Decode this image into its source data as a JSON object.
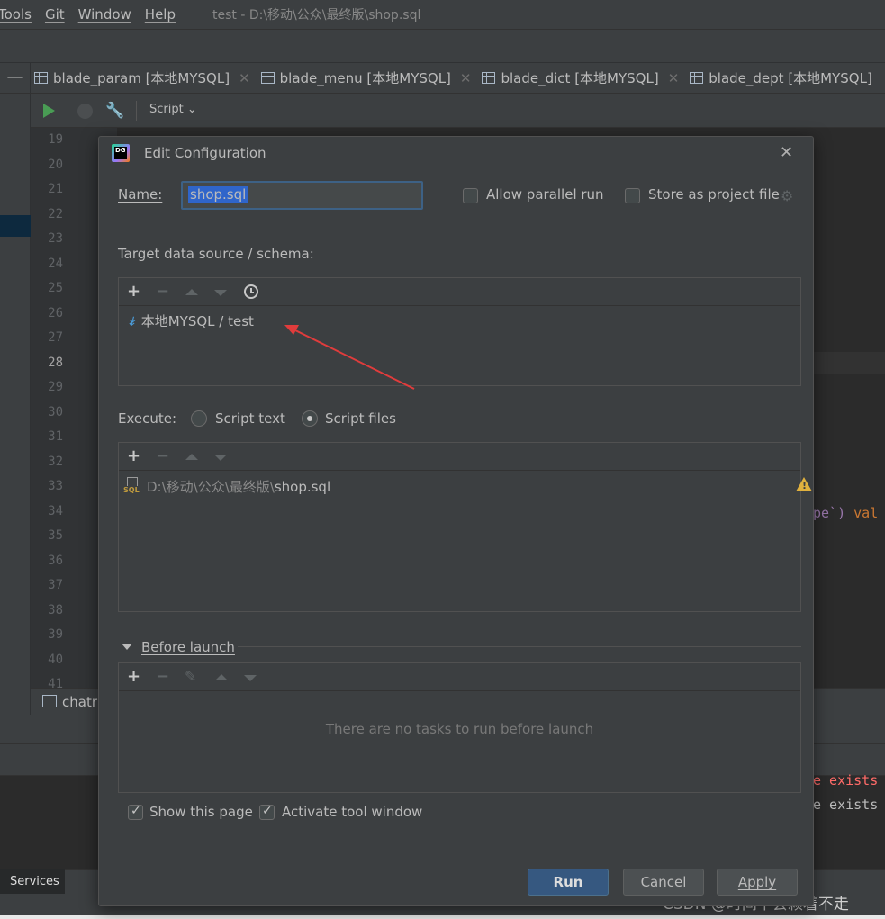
{
  "menubar": {
    "items": [
      "Tools",
      "Git",
      "Window",
      "Help"
    ],
    "window_title": "test - D:\\移动\\公众\\最终版\\shop.sql"
  },
  "editor_tabs": [
    {
      "label": "blade_param [本地MYSQL]"
    },
    {
      "label": "blade_menu [本地MYSQL]"
    },
    {
      "label": "blade_dict [本地MYSQL]"
    },
    {
      "label": "blade_dept [本地MYSQL]"
    }
  ],
  "runbar": {
    "script_label": "Script"
  },
  "gutter": {
    "line_numbers": [
      "19",
      "20",
      "21",
      "22",
      "23",
      "24",
      "25",
      "26",
      "27",
      "28",
      "29",
      "30",
      "31",
      "32",
      "33",
      "34",
      "35",
      "36",
      "37",
      "38",
      "39",
      "40",
      "41"
    ],
    "current_line": "28"
  },
  "code_fragments": {
    "line34": "pe`) val",
    "err1": "e exists",
    "err2": "e exists"
  },
  "bottom_tab": {
    "label": "chatr"
  },
  "services_tab": {
    "label": "Services"
  },
  "watermark": "CSDN @时间不会赖着不走",
  "dialog": {
    "title": "Edit Configuration",
    "name_label": "Name:",
    "name_value": "shop.sql",
    "allow_parallel": {
      "label": "Allow parallel run",
      "checked": false
    },
    "store_project": {
      "label": "Store as project file",
      "checked": false
    },
    "target_label": "Target data source / schema:",
    "target_items": [
      {
        "text": "本地MYSQL / test"
      }
    ],
    "execute_label": "Execute:",
    "execute_options": [
      {
        "label": "Script text",
        "selected": false
      },
      {
        "label": "Script files",
        "selected": true
      }
    ],
    "files": [
      {
        "dir": "D:\\移动\\公众\\最终版\\",
        "name": "shop.sql"
      }
    ],
    "before_launch_label": "Before launch",
    "before_launch_empty": "There are no tasks to run before launch",
    "show_page": {
      "label": "Show this page",
      "checked": true
    },
    "activate_tool": {
      "label": "Activate tool window",
      "checked": true
    },
    "buttons": {
      "run": "Run",
      "cancel": "Cancel",
      "apply": "Apply"
    }
  },
  "colors": {
    "accent_primary": "#365880",
    "selection": "#2f65ca",
    "warning": "#e0b13e",
    "arrow": "#e03c3c",
    "error_text": "#ff6b68",
    "keyword": "#cc7832",
    "identifier": "#9876aa"
  }
}
